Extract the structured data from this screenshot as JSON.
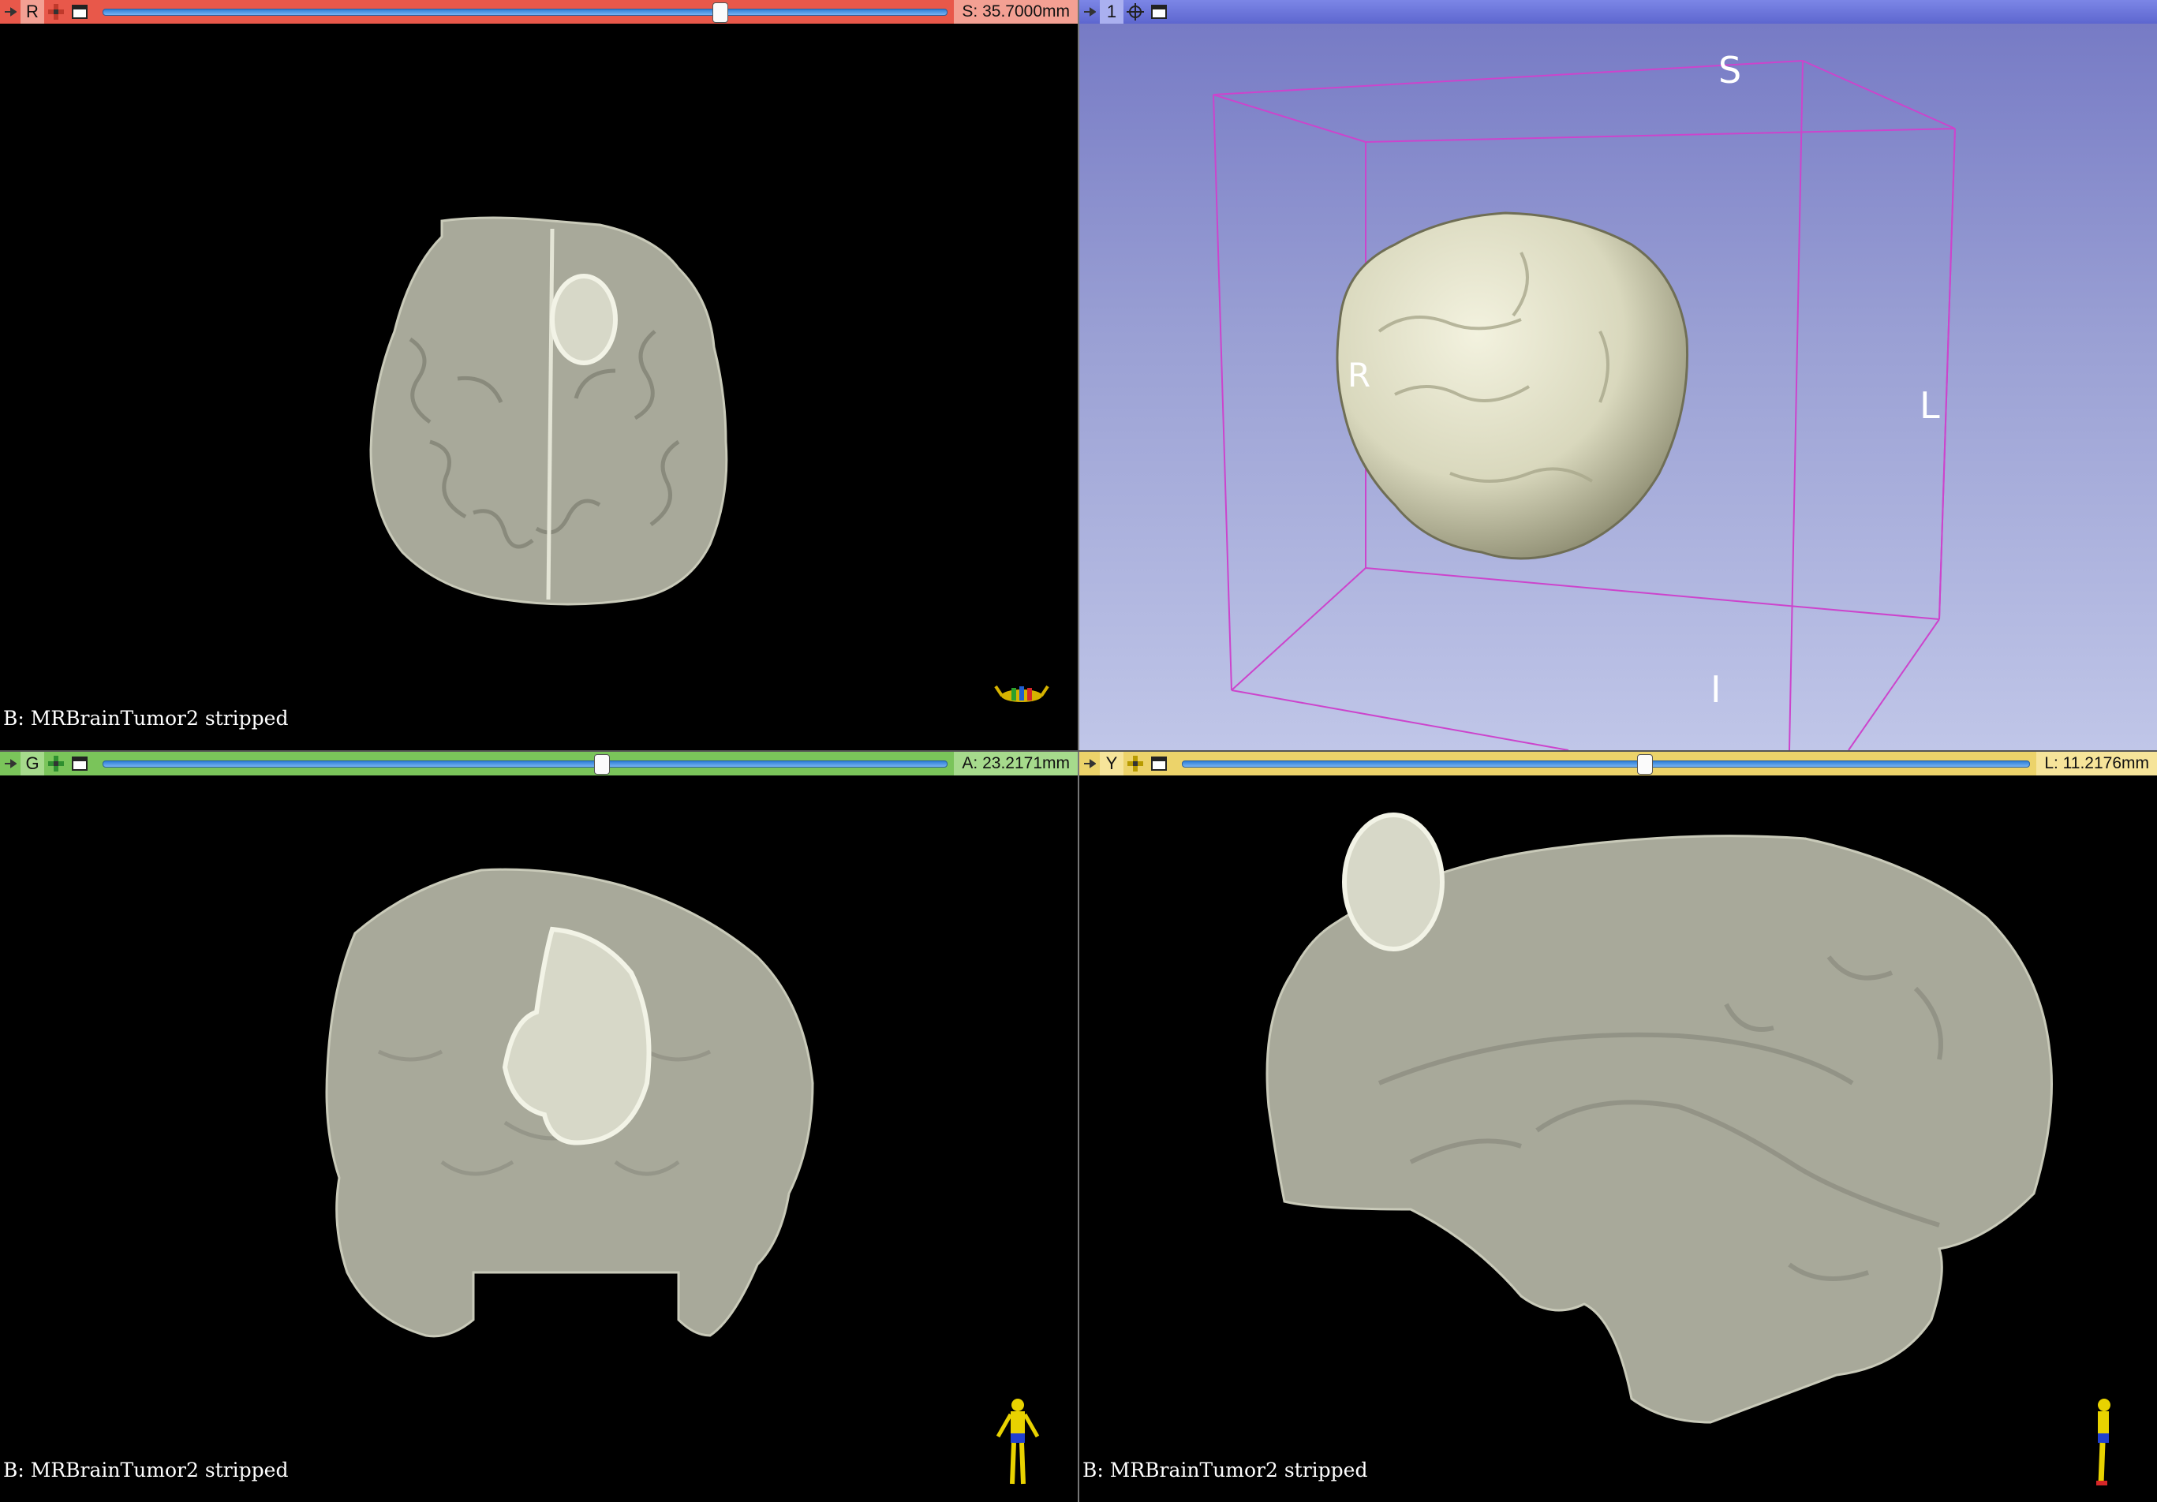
{
  "views": {
    "red": {
      "letter": "R",
      "offset": "S: 35.7000mm",
      "slider_fraction": 0.73,
      "background_label": "B: MRBrainTumor2 stripped",
      "color": "#e8584a"
    },
    "threed": {
      "letter": "1",
      "orientation": {
        "superior": "S",
        "right": "R",
        "left": "L",
        "inferior": "I"
      },
      "color": "#6a72d8"
    },
    "green": {
      "letter": "G",
      "offset": "A: 23.2171mm",
      "slider_fraction": 0.59,
      "background_label": "B: MRBrainTumor2 stripped",
      "color": "#7ac45a"
    },
    "yellow": {
      "letter": "Y",
      "offset": "L: 11.2176mm",
      "slider_fraction": 0.545,
      "background_label": "B: MRBrainTumor2 stripped",
      "color": "#ecd36a"
    }
  },
  "icons": {
    "pin": "pin-icon",
    "link": "crosshair-link-icon",
    "maximize": "maximize-window-icon",
    "center": "center-view-icon"
  }
}
